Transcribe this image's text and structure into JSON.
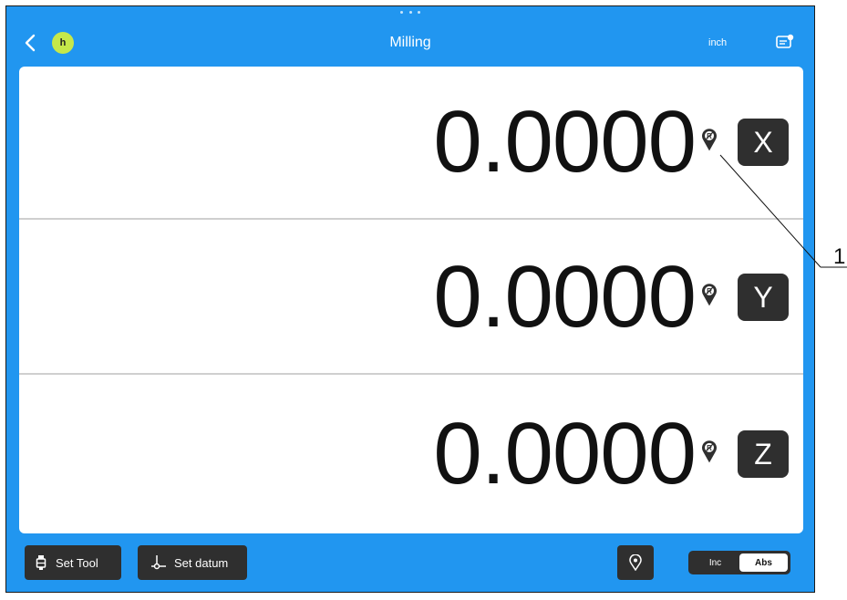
{
  "header": {
    "avatar_letter": "h",
    "title": "Milling",
    "unit": "inch",
    "icons": [
      "chevron-left-icon",
      "user-avatar",
      "settings-screen-icon"
    ]
  },
  "axes": [
    {
      "value": "0.0000",
      "label": "X",
      "icon": "reference-mark-icon"
    },
    {
      "value": "0.0000",
      "label": "Y",
      "icon": "reference-mark-icon"
    },
    {
      "value": "0.0000",
      "label": "Z",
      "icon": "reference-mark-icon"
    }
  ],
  "footer": {
    "set_tool": "Set Tool",
    "set_datum": "Set datum",
    "reference_icon": "location-pin-icon",
    "toggle": {
      "inc": "Inc",
      "abs": "Abs",
      "selected": "Abs"
    }
  },
  "annotation": {
    "callout": "1"
  },
  "colors": {
    "accent": "#2196f0",
    "button": "#2f2f2f",
    "avatar": "#c6e84a"
  }
}
